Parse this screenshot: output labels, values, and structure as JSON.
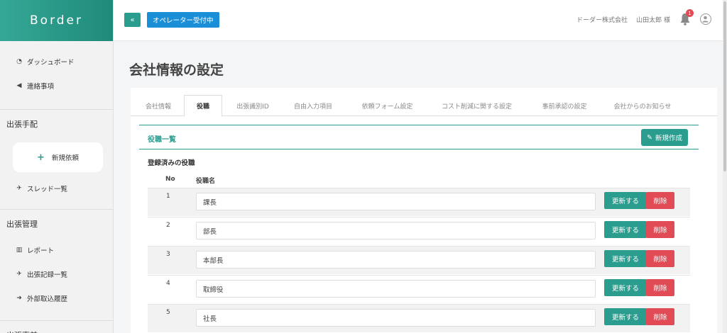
{
  "brand": "Border",
  "sidebar": {
    "items_top": [
      {
        "label": "ダッシュボード",
        "icon": "dashboard-icon"
      },
      {
        "label": "連絡事項",
        "icon": "megaphone-icon"
      }
    ],
    "section1": "出張手配",
    "new_request": "新規依頼",
    "thread_list": "スレッド一覧",
    "section2": "出張管理",
    "items_mgmt": [
      {
        "label": "レポート",
        "icon": "chart-icon"
      },
      {
        "label": "出張記録一覧",
        "icon": "plane-icon"
      },
      {
        "label": "外部取込履歴",
        "icon": "import-icon"
      }
    ],
    "section3": "出張事前"
  },
  "topbar": {
    "collapse": "«",
    "operator": "オペレーター受付中",
    "company": "ドーダー株式会社",
    "user": "山田太郎 様",
    "notification_count": "1"
  },
  "page_title": "会社情報の設定",
  "tabs": [
    "会社情報",
    "役職",
    "出張識別ID",
    "自由入力項目",
    "依頼フォーム設定",
    "コスト削減に関する設定",
    "事前承認の設定",
    "会社からのお知らせ"
  ],
  "active_tab": "役職",
  "section": {
    "title": "役職一覧",
    "create_button": "新規作成",
    "registered_title": "登録済みの役職",
    "col_no": "No",
    "col_name": "役職名",
    "update_label": "更新する",
    "delete_label": "削除"
  },
  "rows": [
    {
      "no": "1",
      "name": "課長"
    },
    {
      "no": "2",
      "name": "部長"
    },
    {
      "no": "3",
      "name": "本部長"
    },
    {
      "no": "4",
      "name": "取締役"
    },
    {
      "no": "5",
      "name": "社長"
    }
  ],
  "colors": {
    "accent": "#2a9d8f",
    "danger": "#e04b55",
    "operator": "#1a8fd8"
  }
}
